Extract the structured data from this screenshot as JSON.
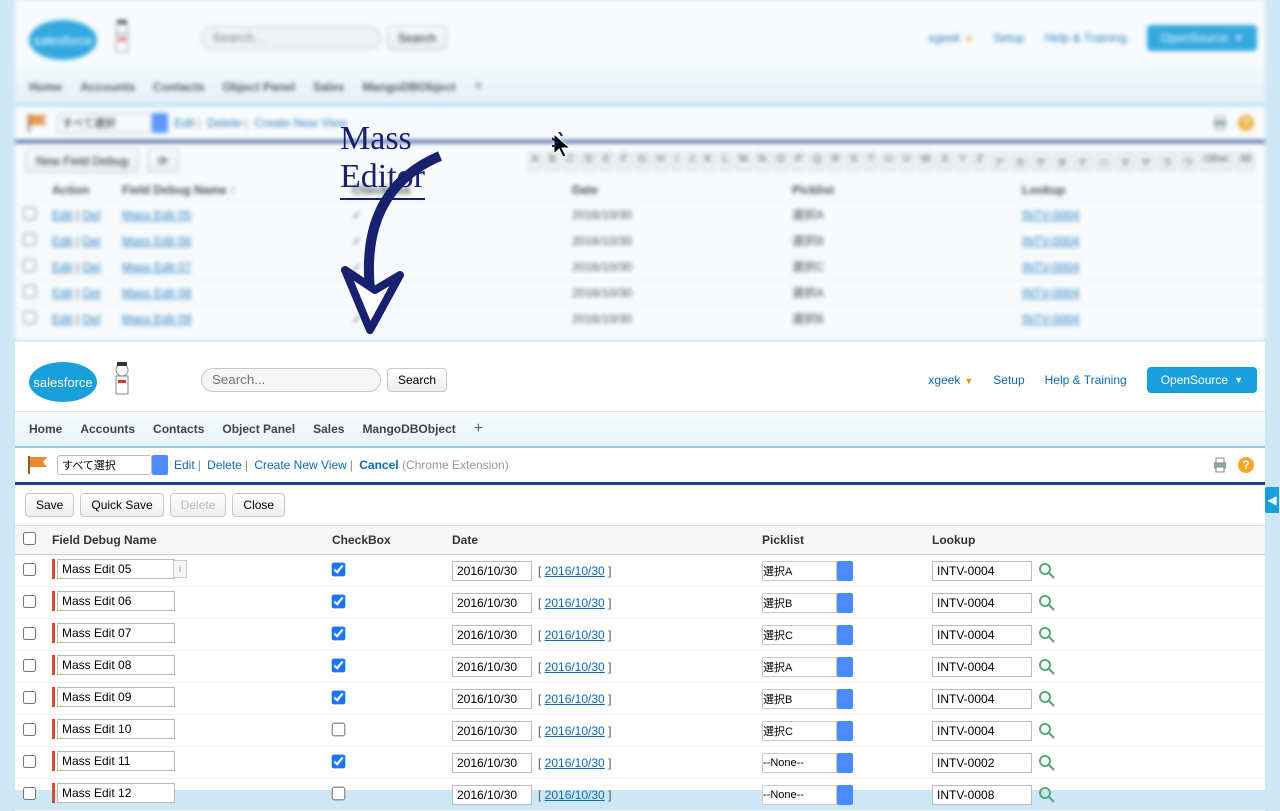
{
  "header": {
    "search_placeholder": "Search...",
    "search_button": "Search",
    "user": "xgeek",
    "setup": "Setup",
    "help": "Help & Training",
    "app": "OpenSource"
  },
  "nav": [
    "Home",
    "Accounts",
    "Contacts",
    "Object Panel",
    "Sales",
    "MangoDBObject"
  ],
  "view": {
    "select_value": "すべて選択",
    "edit": "Edit",
    "delete": "Delete",
    "create": "Create New View",
    "cancel": "Cancel",
    "ext_note": "(Chrome Extension)"
  },
  "top_toolbar": {
    "new_btn": "New Field Debug"
  },
  "alpha": [
    "A",
    "B",
    "C",
    "D",
    "E",
    "F",
    "G",
    "H",
    "I",
    "J",
    "K",
    "L",
    "M",
    "N",
    "O",
    "P",
    "Q",
    "R",
    "S",
    "T",
    "U",
    "V",
    "W",
    "X",
    "Y",
    "Z",
    "ア",
    "カ",
    "サ",
    "タ",
    "ナ",
    "ハ",
    "マ",
    "ヤ",
    "ラ",
    "ワ",
    "Other",
    "All"
  ],
  "top_table": {
    "headers": {
      "action": "Action",
      "name": "Field Debug Name ↑",
      "checkbox": "CheckBox",
      "date": "Date",
      "picklist": "Picklist",
      "lookup": "Lookup"
    },
    "edit": "Edit",
    "del": "Del",
    "rows": [
      {
        "name": "Mass Edit 05",
        "date": "2016/10/30",
        "picklist": "選択A",
        "lookup": "INTV-0004"
      },
      {
        "name": "Mass Edit 06",
        "date": "2016/10/30",
        "picklist": "選択B",
        "lookup": "INTV-0004"
      },
      {
        "name": "Mass Edit 07",
        "date": "2016/10/30",
        "picklist": "選択C",
        "lookup": "INTV-0004"
      },
      {
        "name": "Mass Edit 08",
        "date": "2016/10/30",
        "picklist": "選択A",
        "lookup": "INTV-0004"
      },
      {
        "name": "Mass Edit 09",
        "date": "2016/10/30",
        "picklist": "選択B",
        "lookup": "INTV-0004"
      }
    ]
  },
  "savebar": {
    "save": "Save",
    "quick_save": "Quick Save",
    "delete": "Delete",
    "close": "Close"
  },
  "table": {
    "headers": {
      "name": "Field Debug Name",
      "checkbox": "CheckBox",
      "date": "Date",
      "picklist": "Picklist",
      "lookup": "Lookup"
    },
    "rows": [
      {
        "name": "Mass Edit 05",
        "hint": true,
        "checked": true,
        "date": "2016/10/30",
        "date_hint": "2016/10/30",
        "picklist": "選択A",
        "lookup": "INTV-0004"
      },
      {
        "name": "Mass Edit 06",
        "hint": false,
        "checked": true,
        "date": "2016/10/30",
        "date_hint": "2016/10/30",
        "picklist": "選択B",
        "lookup": "INTV-0004"
      },
      {
        "name": "Mass Edit 07",
        "hint": false,
        "checked": true,
        "date": "2016/10/30",
        "date_hint": "2016/10/30",
        "picklist": "選択C",
        "lookup": "INTV-0004"
      },
      {
        "name": "Mass Edit 08",
        "hint": false,
        "checked": true,
        "date": "2016/10/30",
        "date_hint": "2016/10/30",
        "picklist": "選択A",
        "lookup": "INTV-0004"
      },
      {
        "name": "Mass Edit 09",
        "hint": false,
        "checked": true,
        "date": "2016/10/30",
        "date_hint": "2016/10/30",
        "picklist": "選択B",
        "lookup": "INTV-0004"
      },
      {
        "name": "Mass Edit 10",
        "hint": false,
        "checked": false,
        "date": "2016/10/30",
        "date_hint": "2016/10/30",
        "picklist": "選択C",
        "lookup": "INTV-0004"
      },
      {
        "name": "Mass Edit 11",
        "hint": false,
        "checked": true,
        "date": "2016/10/30",
        "date_hint": "2016/10/30",
        "picklist": "--None--",
        "lookup": "INTV-0002"
      },
      {
        "name": "Mass Edit 12",
        "hint": false,
        "checked": false,
        "date": "2016/10/30",
        "date_hint": "2016/10/30",
        "picklist": "--None--",
        "lookup": "INTV-0008"
      }
    ]
  },
  "annotation": {
    "title": "Mass Editor"
  }
}
